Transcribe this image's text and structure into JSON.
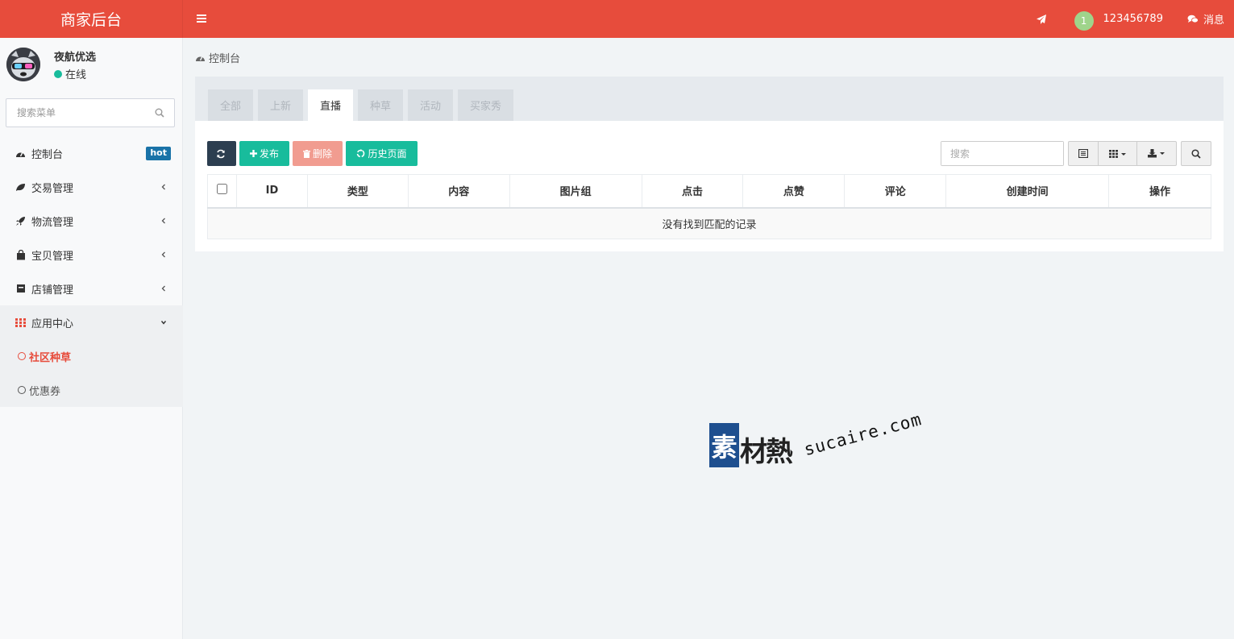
{
  "app": {
    "title": "商家后台"
  },
  "header": {
    "user_badge": "1",
    "username": "123456789",
    "messages_label": "消息",
    "color": "#e74c3c"
  },
  "sidebar": {
    "user": {
      "name": "夜航优选",
      "status": "在线"
    },
    "search_placeholder": "搜索菜单",
    "items": [
      {
        "label": "控制台",
        "icon": "dashboard-icon",
        "badge": "hot"
      },
      {
        "label": "交易管理",
        "icon": "leaf-icon"
      },
      {
        "label": "物流管理",
        "icon": "rocket-icon"
      },
      {
        "label": "宝贝管理",
        "icon": "shopping-bag-icon"
      },
      {
        "label": "店铺管理",
        "icon": "store-icon"
      },
      {
        "label": "应用中心",
        "icon": "apps-grid-icon",
        "expanded": true
      }
    ],
    "sub_items": [
      {
        "label": "社区种草",
        "active": true
      },
      {
        "label": "优惠券",
        "active": false
      }
    ]
  },
  "breadcrumb": {
    "label": "控制台"
  },
  "tabs": [
    {
      "label": "全部",
      "active": false
    },
    {
      "label": "上新",
      "active": false
    },
    {
      "label": "直播",
      "active": true
    },
    {
      "label": "种草",
      "active": false
    },
    {
      "label": "活动",
      "active": false
    },
    {
      "label": "买家秀",
      "active": false
    }
  ],
  "toolbar": {
    "publish_label": "发布",
    "delete_label": "删除",
    "history_label": "历史页面",
    "search_placeholder": "搜索"
  },
  "table": {
    "columns": [
      "ID",
      "类型",
      "内容",
      "图片组",
      "点击",
      "点赞",
      "评论",
      "创建时间",
      "操作"
    ],
    "empty_text": "没有找到匹配的记录"
  },
  "watermark": {
    "brand": "素材熱",
    "url": "sucaire.com"
  }
}
